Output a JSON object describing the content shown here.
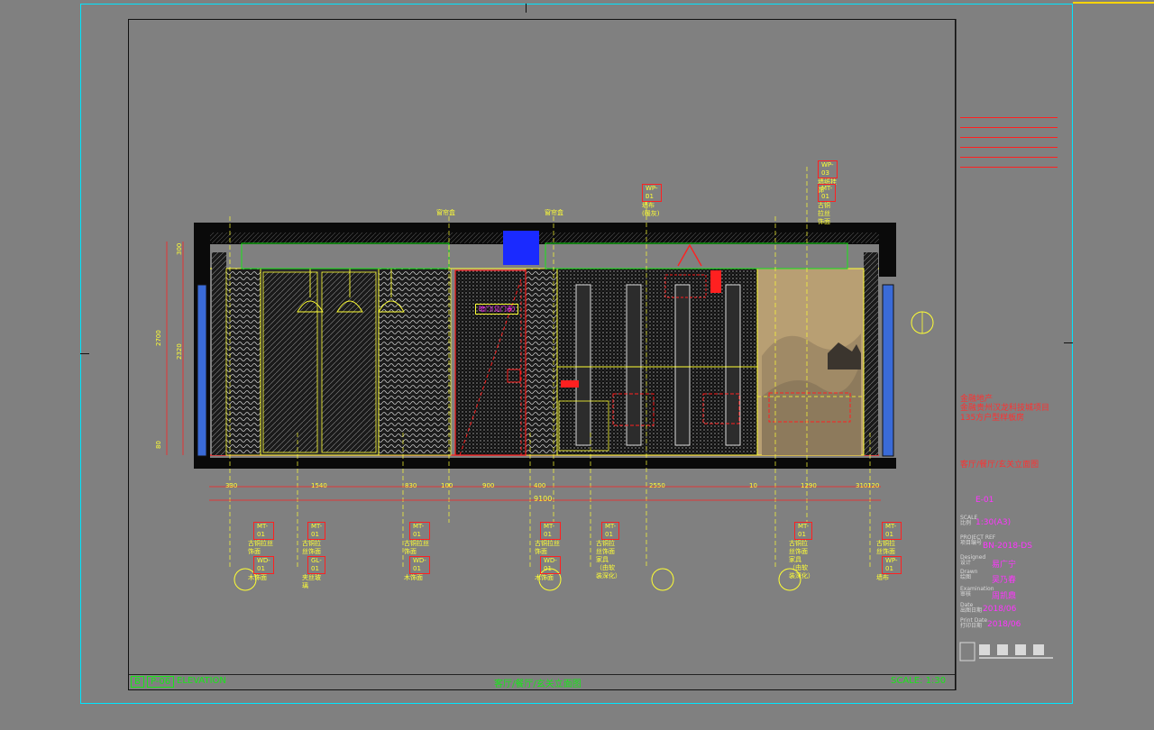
{
  "drawing": {
    "view_name": "客厅/餐厅/玄关立面图",
    "scale_text": "SCALE: 1:30",
    "elevation_code": "P-06",
    "elevation_word": "ELEVATION",
    "elevation_mark": "B"
  },
  "dimensions": {
    "bottom": [
      "330",
      "1540",
      "830",
      "100",
      "900",
      "400",
      "2550",
      "10",
      "1290",
      "310",
      "120"
    ],
    "total": "9100",
    "left_vertical": [
      "2700",
      "2320",
      "300",
      "80"
    ]
  },
  "material_tags": {
    "top": [
      {
        "code": "WP-01",
        "desc": "墙布(暖灰)"
      },
      {
        "code": "WP-03",
        "desc": "墙纸挂饰"
      },
      {
        "code": "MT-01",
        "desc": "古铜拉丝饰面"
      }
    ],
    "bottom": [
      {
        "code1": "MT-01",
        "desc1": "古铜拉丝饰面",
        "code2": "WD-01",
        "desc2": "木饰面"
      },
      {
        "code1": "MT-01",
        "desc1": "古铜拉丝饰面",
        "code2": "GL-01",
        "desc2": "夹丝玻璃"
      },
      {
        "code1": "MT-01",
        "desc1": "古铜拉丝饰面",
        "code2": "WD-01",
        "desc2": "木饰面"
      },
      {
        "code1": "MT-01",
        "desc1": "古铜拉丝饰面",
        "code2": "WD-01",
        "desc2": "木饰面"
      },
      {
        "code1": "MT-01",
        "desc1": "古铜拉丝饰面",
        "code2": "",
        "desc2": "家具",
        "desc3": "（由软装深化）"
      },
      {
        "code1": "MT-01",
        "desc1": "古铜拉丝饰面",
        "code2": "",
        "desc2": "家具",
        "desc3": "（由软装深化）"
      },
      {
        "code1": "MT-01",
        "desc1": "古铜拉丝饰面",
        "code2": "WP-01",
        "desc2": "墙布"
      }
    ]
  },
  "callouts": {
    "curtain_track": "窗帘盒",
    "door_label": "暗门(见门表)"
  },
  "title_block": {
    "project_lines": [
      "金融地产",
      "金融贵州汉龙科技城项目",
      "135方户型样板房"
    ],
    "drawing_title": "客厅/餐厅/玄关立面图",
    "sheet_no": "E-01",
    "scale_value": "1:30(A3)",
    "project_ref_value": "BN-2018-DS",
    "designed_value": "易广宁",
    "drawn_value": "吴乃春",
    "exam_value": "周凯鼎",
    "date_value": "2018/06",
    "print_value": "2018/06",
    "labels": {
      "scale": "SCALE\n比例",
      "project_ref": "PROJECT REF\n项目编号",
      "designed": "Designed\n设计",
      "drawn": "Drawn\n绘图",
      "exam": "Examination\n审核",
      "date": "Date\n出图日期",
      "print": "Print Date\n打印日期"
    }
  },
  "colors": {
    "frame": "#00e5ff",
    "wall_black": "#0a0a0a",
    "line_yellow": "#ffff33",
    "line_red": "#ff2020",
    "accent_green": "#19e619",
    "accent_magenta": "#ff33ff",
    "accent_blue": "#1a2aff"
  }
}
